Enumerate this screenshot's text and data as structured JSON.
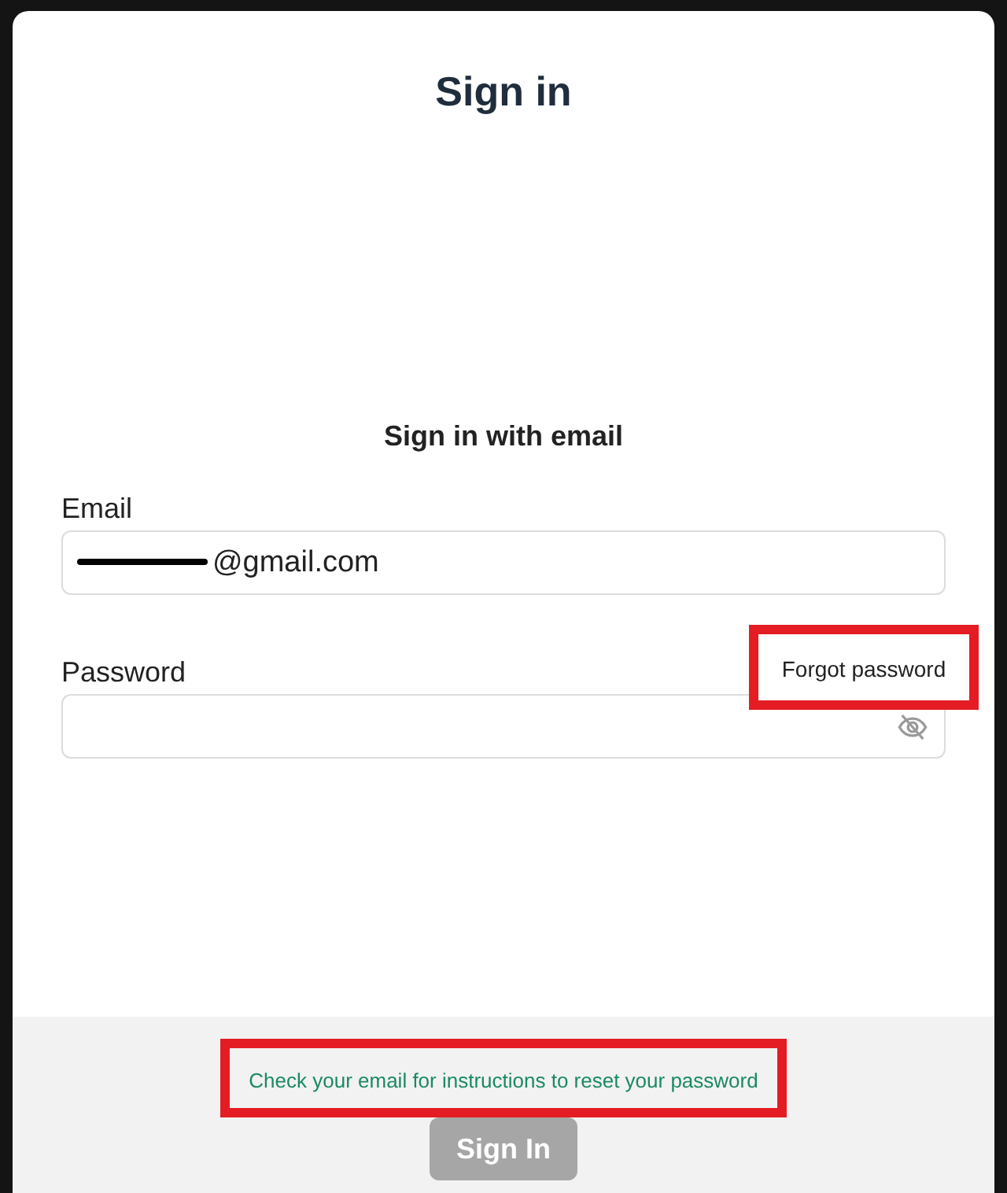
{
  "title": "Sign in",
  "subtitle": "Sign in with email",
  "fields": [
    {
      "kind": "email",
      "label": "Email",
      "value": "@gmail.com",
      "redacted": true
    },
    {
      "kind": "password",
      "label": "Password",
      "link": "Forgot password",
      "link_highlighted": true,
      "password_visible": false
    }
  ],
  "footer": {
    "message": "Check your email for instructions to reset your password",
    "message_highlighted": true,
    "button": {
      "label": "Sign In",
      "disabled": true
    }
  }
}
